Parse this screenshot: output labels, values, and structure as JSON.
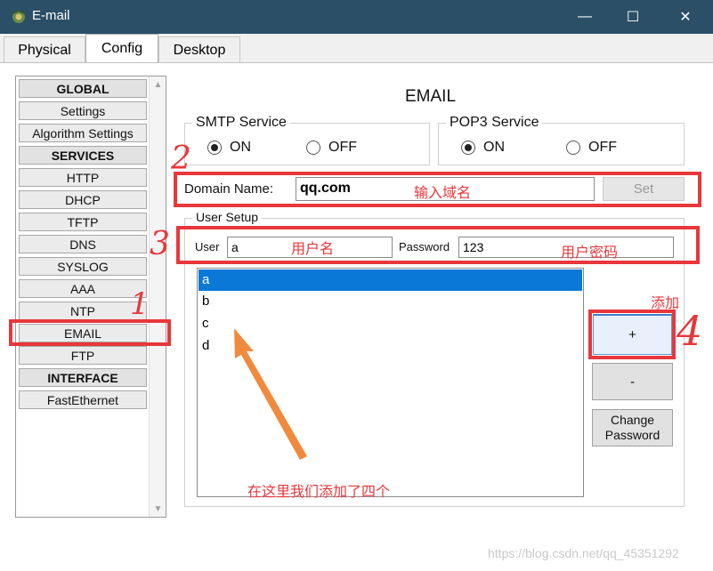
{
  "window": {
    "title": "E-mail",
    "controls": {
      "minimize": "—",
      "maximize": "☐",
      "close": "✕"
    }
  },
  "tabs": [
    {
      "label": "Physical",
      "active": false
    },
    {
      "label": "Config",
      "active": true
    },
    {
      "label": "Desktop",
      "active": false
    }
  ],
  "sidebar": {
    "items": [
      {
        "label": "GLOBAL",
        "header": true
      },
      {
        "label": "Settings",
        "header": false
      },
      {
        "label": "Algorithm Settings",
        "header": false
      },
      {
        "label": "SERVICES",
        "header": true
      },
      {
        "label": "HTTP",
        "header": false
      },
      {
        "label": "DHCP",
        "header": false
      },
      {
        "label": "TFTP",
        "header": false
      },
      {
        "label": "DNS",
        "header": false
      },
      {
        "label": "SYSLOG",
        "header": false
      },
      {
        "label": "AAA",
        "header": false
      },
      {
        "label": "NTP",
        "header": false
      },
      {
        "label": "EMAIL",
        "header": false,
        "selected": true
      },
      {
        "label": "FTP",
        "header": false
      },
      {
        "label": "INTERFACE",
        "header": true
      },
      {
        "label": "FastEthernet",
        "header": false
      }
    ]
  },
  "main": {
    "title": "EMAIL",
    "smtp": {
      "label": "SMTP Service",
      "on_label": "ON",
      "off_label": "OFF",
      "value": "ON"
    },
    "pop3": {
      "label": "POP3 Service",
      "on_label": "ON",
      "off_label": "OFF",
      "value": "ON"
    },
    "domain": {
      "label": "Domain Name:",
      "value": "qq.com",
      "set_label": "Set"
    },
    "user_setup": {
      "label": "User Setup",
      "user_label": "User",
      "user_value": "a",
      "password_label": "Password",
      "password_value": "123",
      "users": [
        "a",
        "b",
        "c",
        "d"
      ],
      "selected_user": "a",
      "add_label": "+",
      "remove_label": "-",
      "change_password_label": "Change Password"
    }
  },
  "annotations": {
    "num1": "1",
    "num2": "2",
    "num3": "3",
    "num4": "4",
    "domain_note": "输入域名",
    "username_note": "用户名",
    "password_note": "用户密码",
    "add_note": "添加",
    "list_note": "在这里我们添加了四个"
  },
  "watermark": "https://blog.csdn.net/qq_45351292",
  "colors": {
    "titlebar": "#2b4f66",
    "annotation_red": "#e8373b",
    "arrow_orange": "#f08a3c",
    "selection_blue": "#0a78d7"
  }
}
